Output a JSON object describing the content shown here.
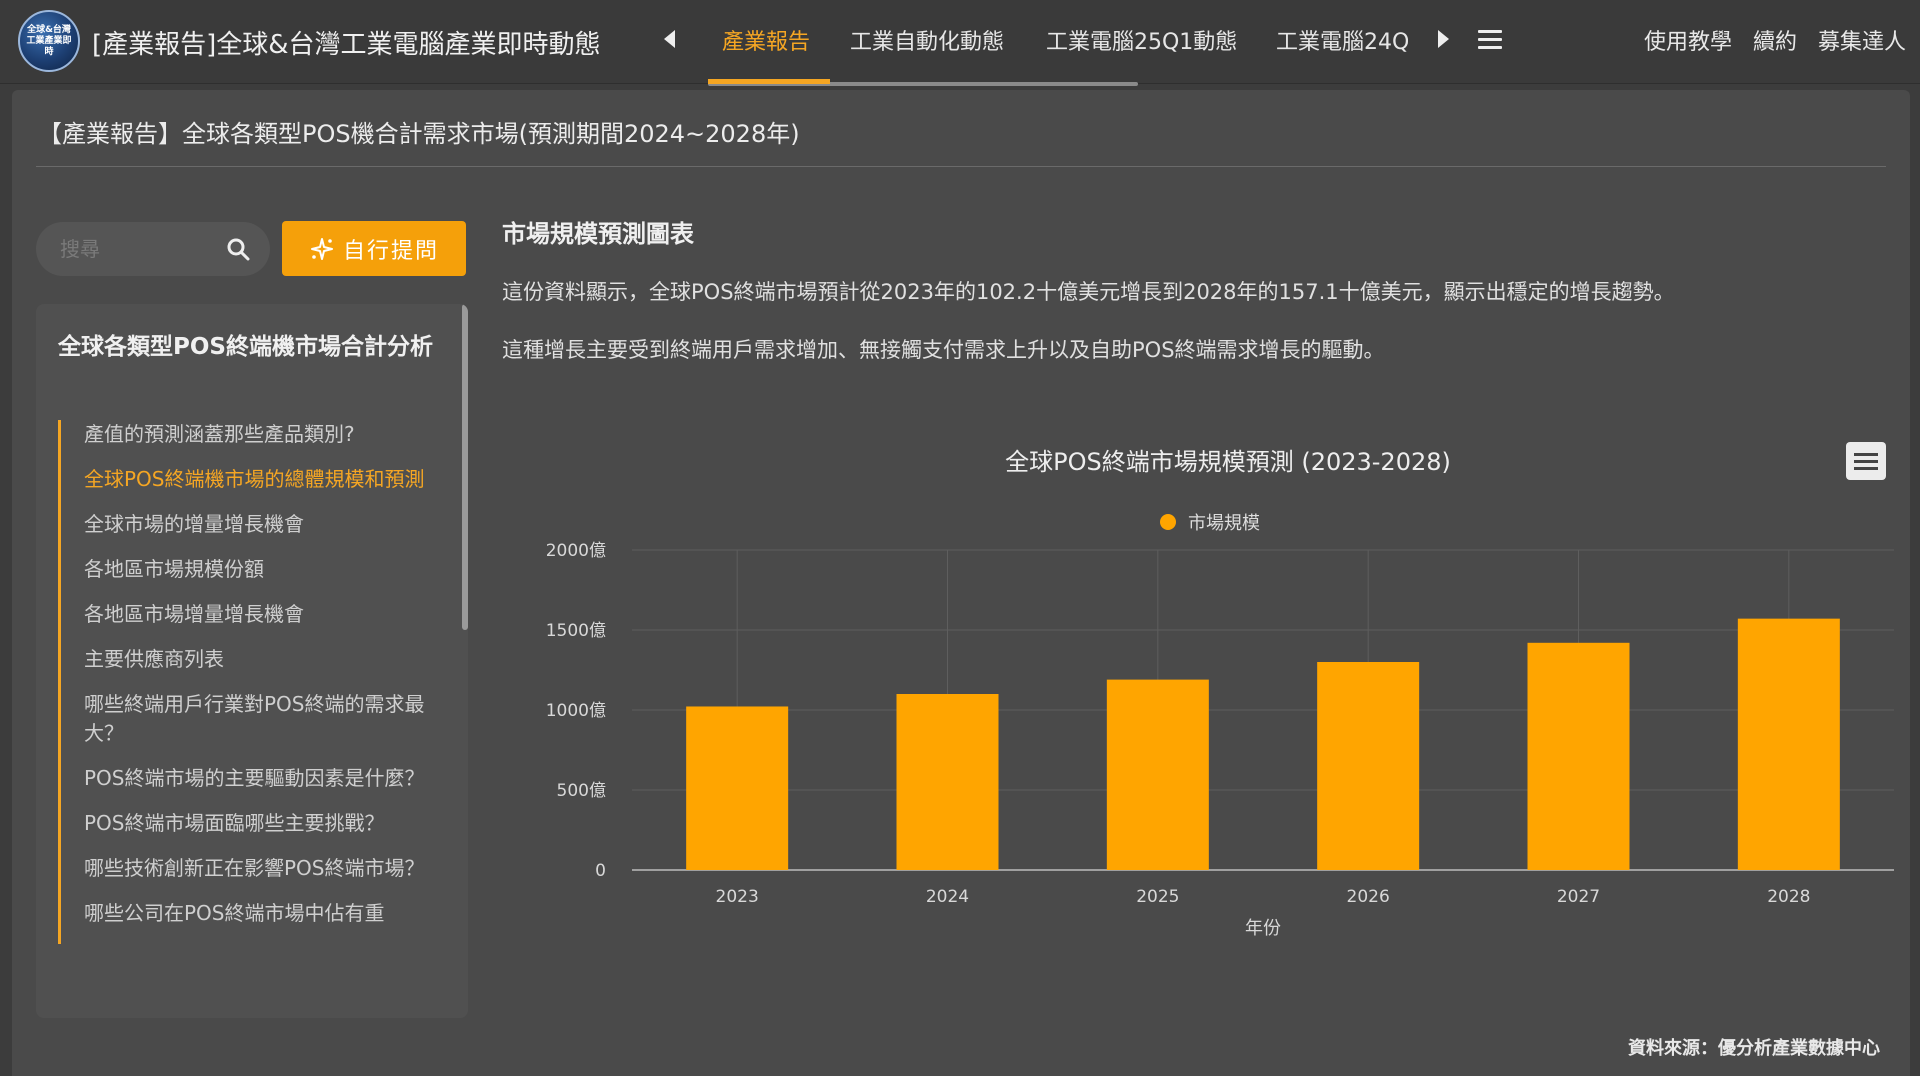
{
  "app": {
    "logo_text": "全球&台灣工業產業即時",
    "title": "[產業報告]全球&台灣工業電腦產業即時動態"
  },
  "tabs": [
    {
      "label": "產業報告",
      "active": true
    },
    {
      "label": "工業自動化動態",
      "active": false
    },
    {
      "label": "工業電腦25Q1動態",
      "active": false
    },
    {
      "label": "工業電腦24Q",
      "active": false
    }
  ],
  "top_links": [
    "使用教學",
    "續約",
    "募集達人"
  ],
  "page_title": "【產業報告】全球各類型POS機合計需求市場(預測期間2024~2028年)",
  "search": {
    "placeholder": "搜尋"
  },
  "ask_button": "自行提問",
  "toc": {
    "title": "全球各類型POS終端機市場合計分析",
    "items": [
      {
        "label": "產值的預測涵蓋那些產品類別?",
        "active": false
      },
      {
        "label": "全球POS終端機市場的總體規模和預測",
        "active": true
      },
      {
        "label": "全球市場的增量增長機會",
        "active": false
      },
      {
        "label": "各地區市場規模份額",
        "active": false
      },
      {
        "label": "各地區市場增量增長機會",
        "active": false
      },
      {
        "label": "主要供應商列表",
        "active": false
      },
      {
        "label": "哪些終端用戶行業對POS終端的需求最大？",
        "active": false
      },
      {
        "label": "POS終端市場的主要驅動因素是什麼？",
        "active": false
      },
      {
        "label": "POS終端市場面臨哪些主要挑戰？",
        "active": false
      },
      {
        "label": "哪些技術創新正在影響POS終端市場？",
        "active": false
      },
      {
        "label": "哪些公司在POS終端市場中佔有重",
        "active": false
      }
    ]
  },
  "content": {
    "section_title": "市場規模預測圖表",
    "paragraph1": "這份資料顯示，全球POS終端市場預計從2023年的102.2十億美元增長到2028年的157.1十億美元，顯示出穩定的增長趨勢。",
    "paragraph2": "這種增長主要受到終端用戶需求增加、無接觸支付需求上升以及自助POS終端需求增長的驅動。"
  },
  "source": "資料來源：優分析產業數據中心",
  "colors": {
    "accent": "#f5a623",
    "bar": "#ffa500",
    "background": "#4a4a4a"
  },
  "chart_data": {
    "type": "bar",
    "title": "全球POS終端市場規模預測 (2023-2028)",
    "xlabel": "年份",
    "ylabel": "",
    "categories": [
      "2023",
      "2024",
      "2025",
      "2026",
      "2027",
      "2028"
    ],
    "series": [
      {
        "name": "市場規模",
        "values": [
          1022,
          1100,
          1190,
          1300,
          1420,
          1571
        ]
      }
    ],
    "ylim": [
      0,
      2000
    ],
    "yticks": [
      {
        "value": 0,
        "label": "0"
      },
      {
        "value": 500,
        "label": "500億"
      },
      {
        "value": 1000,
        "label": "1000億"
      },
      {
        "value": 1500,
        "label": "1500億"
      },
      {
        "value": 2000,
        "label": "2000億"
      }
    ],
    "legend": "top-center",
    "grid": true
  }
}
